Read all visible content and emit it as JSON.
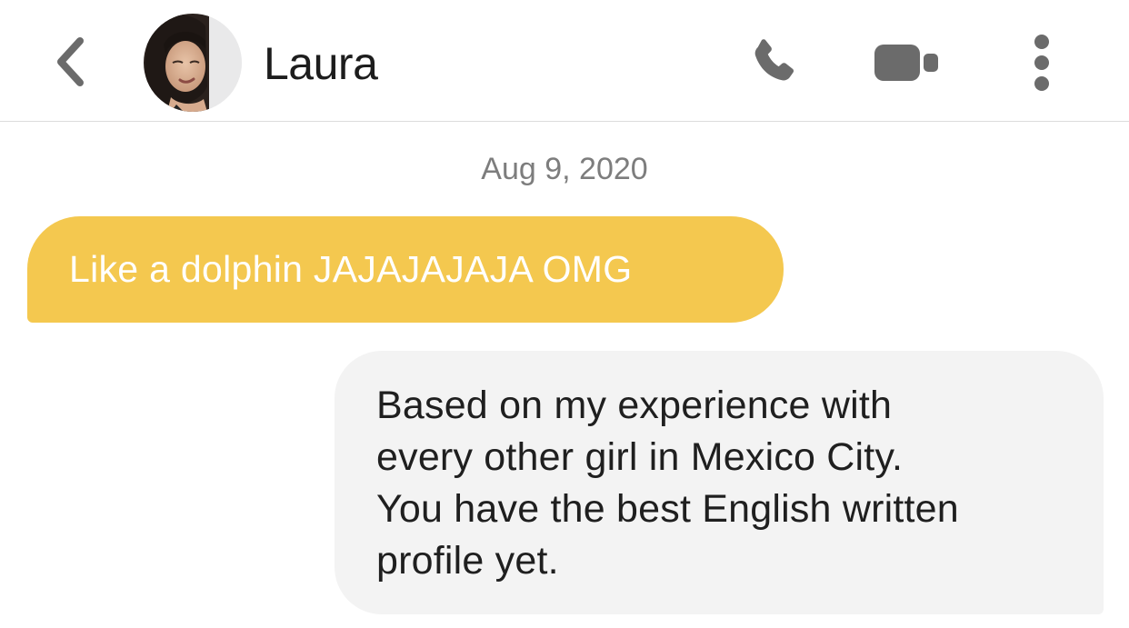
{
  "header": {
    "back_icon": "chevron-left-icon",
    "contact_name": "Laura",
    "call_icon": "phone-icon",
    "video_icon": "video-camera-icon",
    "more_icon": "more-vertical-icon",
    "icon_color": "#6b6b6b"
  },
  "conversation": {
    "date": "Aug 9, 2020",
    "messages": [
      {
        "direction": "incoming",
        "text": "Like a dolphin JAJAJAJAJA OMG",
        "bubble_color": "#f4c84f"
      },
      {
        "direction": "outgoing",
        "lines": [
          "Based on my experience with",
          "every other girl in Mexico City.",
          "You have the best English written",
          "profile yet."
        ],
        "bubble_color": "#f3f3f3"
      }
    ]
  }
}
